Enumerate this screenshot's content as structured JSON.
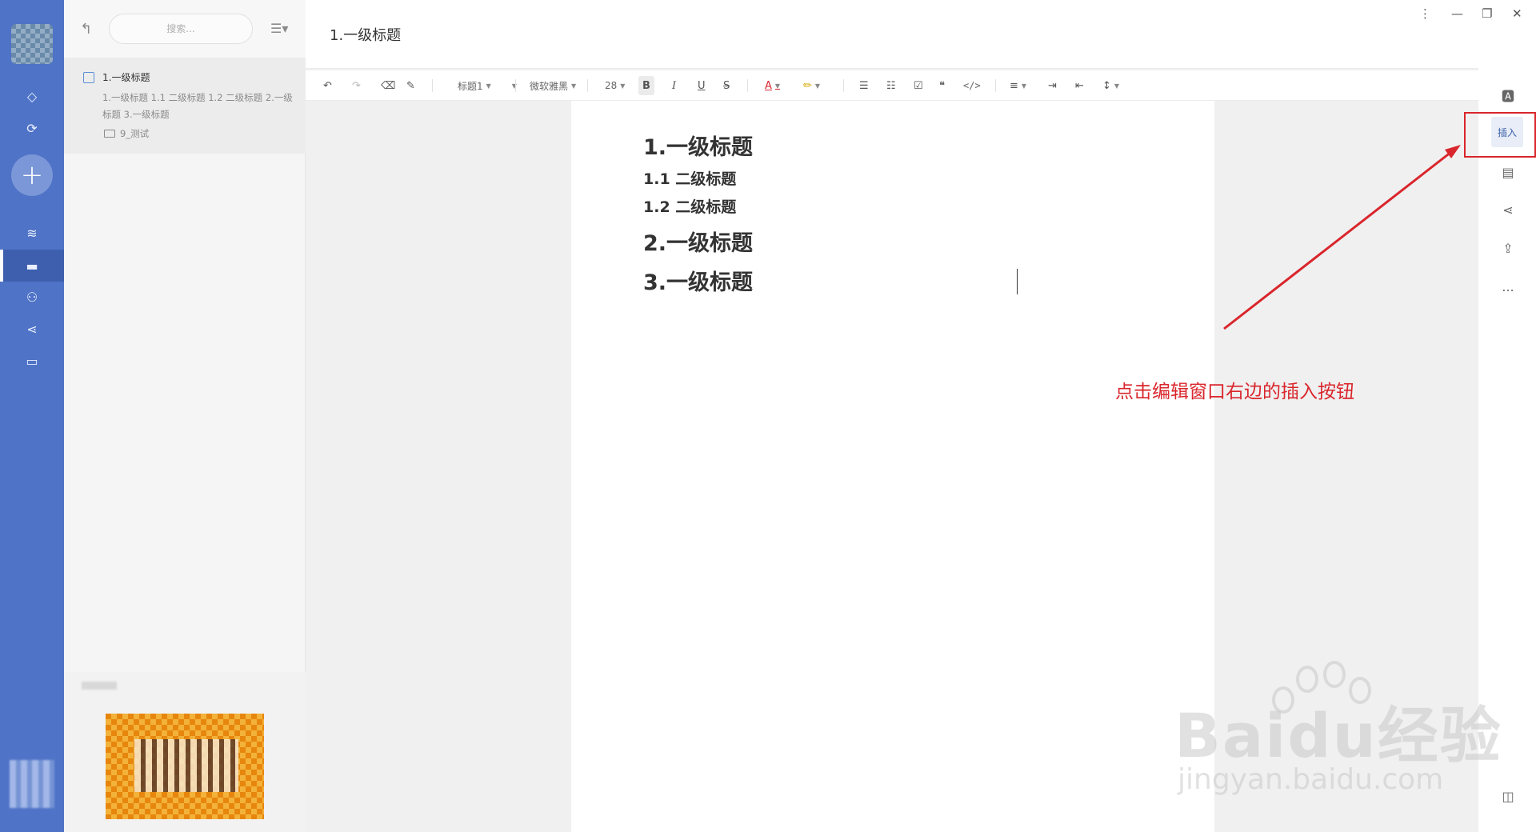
{
  "document": {
    "title": "1.一级标题",
    "headings": [
      {
        "level": 1,
        "text": "1.一级标题"
      },
      {
        "level": 2,
        "text": "1.1 二级标题"
      },
      {
        "level": 2,
        "text": "1.2 二级标题"
      },
      {
        "level": 1,
        "text": "2.一级标题"
      },
      {
        "level": 1,
        "text": "3.一级标题"
      }
    ]
  },
  "note_list": {
    "search_placeholder": "搜索...",
    "item": {
      "title": "1.一级标题",
      "preview": "1.一级标题 1.1 二级标题 1.2 二级标题 2.一级标题 3.一级标题",
      "folder": "9_测试"
    }
  },
  "toolbar": {
    "style_select": "标题1",
    "font_select": "微软雅黑",
    "size_select": "28",
    "bold": "B",
    "italic": "I",
    "underline": "U",
    "strike": "S",
    "font_color": "A",
    "code": "</>"
  },
  "right_panel": {
    "insert_label": "插入",
    "more": "..."
  },
  "annotation": {
    "text": "点击编辑窗口右边的插入按钮",
    "color": "#d9262c"
  },
  "watermark": {
    "main": "Baidu经验",
    "sub": "jingyan.baidu.com"
  },
  "colors": {
    "nav_bg": "#4f73c6",
    "accent": "#3a5fa8",
    "annotation_red": "#d9262c"
  }
}
